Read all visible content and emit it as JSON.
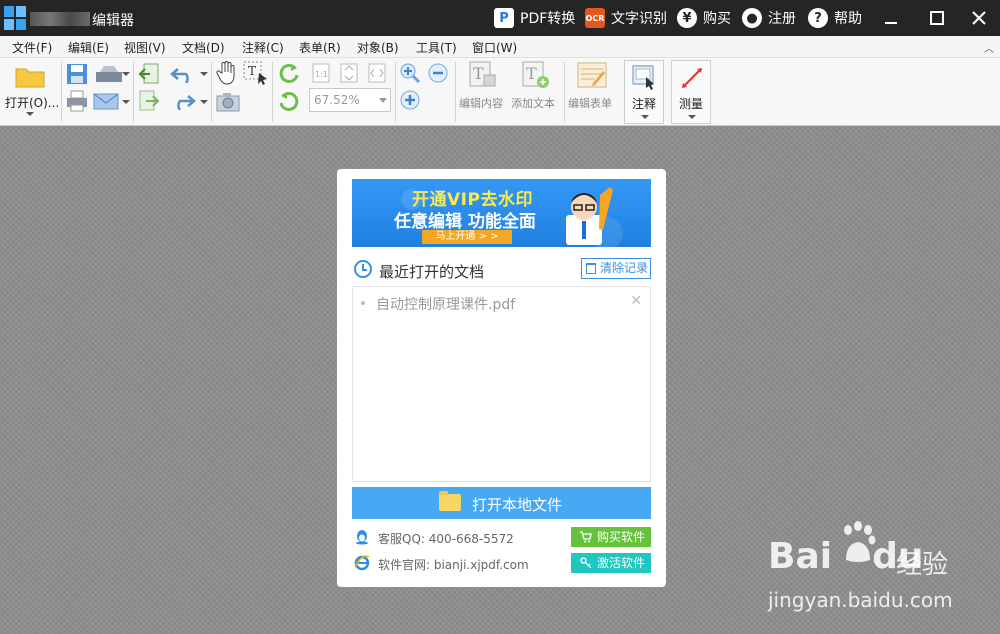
{
  "titlebar": {
    "app_title": "编辑器",
    "actions": [
      {
        "label": "PDF转换",
        "icon": "pdf-convert-icon"
      },
      {
        "label": "文字识别",
        "icon": "ocr-icon"
      },
      {
        "label": "购买",
        "icon": "yen-icon"
      },
      {
        "label": "注册",
        "icon": "user-icon"
      },
      {
        "label": "帮助",
        "icon": "help-icon"
      }
    ]
  },
  "menu": [
    "文件(F)",
    "编辑(E)",
    "视图(V)",
    "文档(D)",
    "注释(C)",
    "表单(R)",
    "对象(B)",
    "工具(T)",
    "窗口(W)"
  ],
  "toolbar": {
    "open_label": "打开(O)...",
    "zoom_value": "67.52%",
    "edit_content": "编辑内容",
    "add_text": "添加文本",
    "edit_form": "编辑表单",
    "annotate": "注释",
    "measure": "测量"
  },
  "panel": {
    "banner": {
      "line1": "开通VIP去水印",
      "line2": "任意编辑  功能全面",
      "button": "马上开通 > >"
    },
    "recent_title": "最近打开的文档",
    "clear_label": "清除记录",
    "recent_files": [
      "自动控制原理课件.pdf"
    ],
    "open_local": "打开本地文件",
    "support_qq": "客服QQ: 400-668-5572",
    "website": "软件官网: bianji.xjpdf.com",
    "buy_label": "购买软件",
    "activate_label": "激活软件"
  },
  "watermark": {
    "brand_latin_1": "Bai",
    "brand_latin_2": "du",
    "brand_cn": "经验",
    "url": "jingyan.baidu.com"
  },
  "colors": {
    "titlebar_bg": "#252525",
    "accent_blue": "#47a8f3",
    "buy_green": "#65c23a",
    "activate_cyan": "#1ec7bf"
  }
}
